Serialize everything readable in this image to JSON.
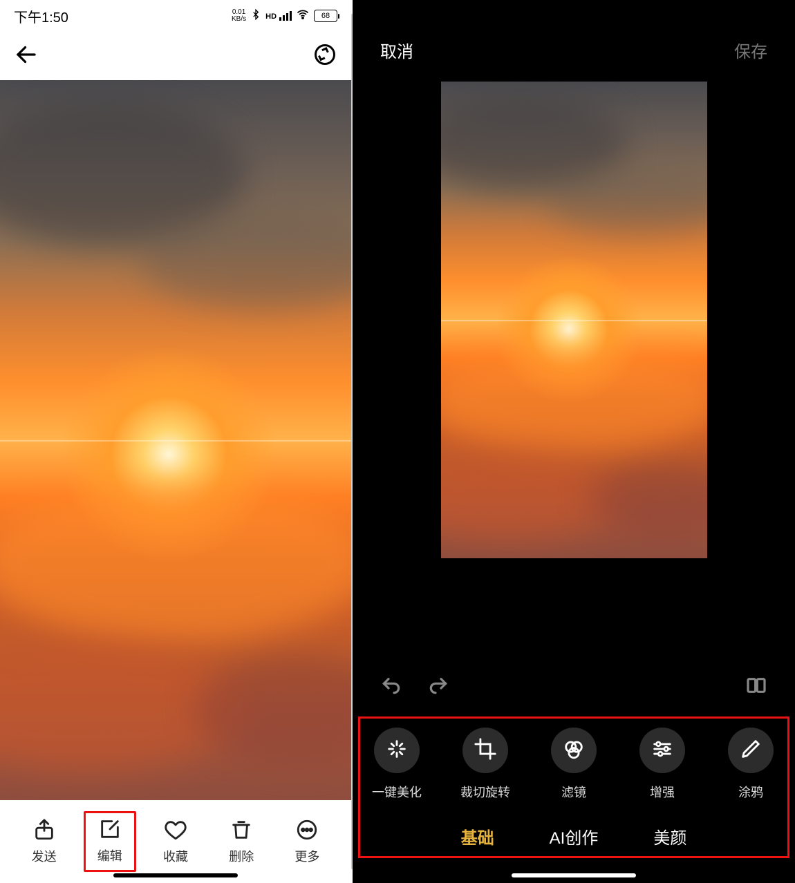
{
  "statusbar": {
    "time": "下午1:50",
    "net_speed_top": "0.01",
    "net_speed_bottom": "KB/s",
    "signal_label": "HD",
    "battery_text": "68"
  },
  "viewer": {
    "actions": {
      "send": "发送",
      "edit": "编辑",
      "favorite": "收藏",
      "delete": "删除",
      "more": "更多"
    }
  },
  "editor": {
    "cancel": "取消",
    "save": "保存",
    "tools": {
      "auto": "一键美化",
      "crop": "裁切旋转",
      "filter": "滤镜",
      "enhance": "增强",
      "doodle": "涂鸦"
    },
    "tabs": {
      "basic": "基础",
      "ai": "AI创作",
      "beauty": "美颜"
    }
  }
}
